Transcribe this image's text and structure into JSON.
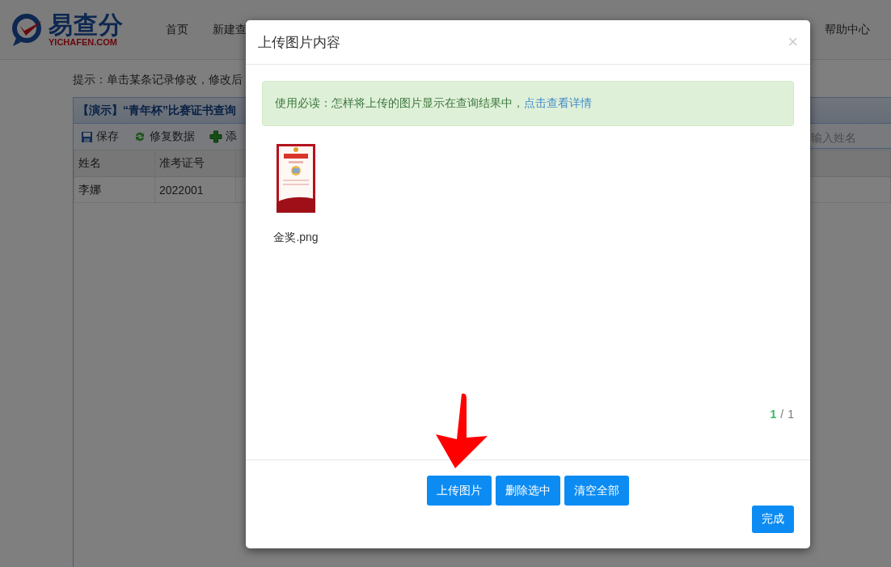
{
  "header": {
    "logo": {
      "name": "易查分",
      "domain": "YICHAFEN.COM"
    },
    "nav": [
      {
        "label": "首页"
      },
      {
        "label": "新建查"
      }
    ],
    "help": "帮助中心"
  },
  "hint": "提示：单击某条记录修改，修改后",
  "panel": {
    "title": "【演示】“青年杯”比赛证书查询",
    "toolbar": [
      {
        "label": "保存",
        "kind": "save"
      },
      {
        "label": "修复数据",
        "kind": "repair"
      },
      {
        "label": "添",
        "kind": "add"
      }
    ],
    "search": {
      "placeholder": "输入姓名"
    },
    "table": {
      "columns": [
        "姓名",
        "准考证号"
      ],
      "rows": [
        [
          "李娜",
          "2022001"
        ]
      ]
    }
  },
  "modal": {
    "title": "上传图片内容",
    "close": "×",
    "notice": {
      "text": "使用必读：怎样将上传的图片显示在查询结果中，",
      "link": "点击查看详情"
    },
    "files": [
      {
        "name": "金奖.png",
        "kind": "picture"
      }
    ],
    "pager": {
      "current": "1",
      "separator": "/",
      "total": "1"
    },
    "actions": [
      "上传图片",
      "删除选中",
      "清空全部"
    ],
    "done": "完成"
  }
}
